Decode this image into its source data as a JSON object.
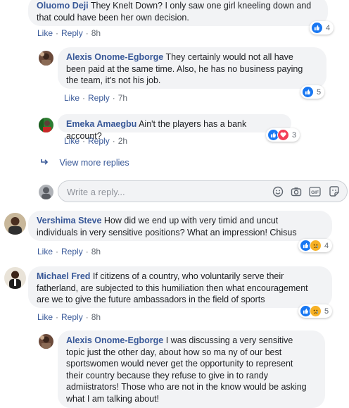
{
  "comments": [
    {
      "name": "Oluomo Deji",
      "text_lines": [
        "They Knelt Down? I only saw one girl kneeling down and",
        "that could have been her own decision."
      ],
      "like": "Like",
      "reply": "Reply",
      "time": "8h",
      "reaction_count": "4"
    },
    {
      "name": "Alexis Onome-Egborge",
      "text_lines": [
        "They certainly would not all have",
        "been paid at the same time. Also, he has no business paying",
        "the team, it's not his job."
      ],
      "like": "Like",
      "reply": "Reply",
      "time": "7h",
      "reaction_count": "5"
    },
    {
      "name": "Emeka Amaegbu",
      "text_lines": [
        "Ain't the players has a bank account?"
      ],
      "like": "Like",
      "reply": "Reply",
      "time": "2h",
      "reaction_count": "3"
    },
    {
      "name": "Vershima Steve",
      "text_lines": [
        "How did we end up with very timid and uncut",
        "individuals in very sensitive positions? What an impression! Chisus"
      ],
      "like": "Like",
      "reply": "Reply",
      "time": "8h",
      "reaction_count": "4"
    },
    {
      "name": "Michael Fred",
      "text_lines": [
        "If citizens of a country, who voluntarily serve their",
        "fatherland, are subjected to this humiliation then what encouragement",
        "are we to give the future ambassadors in the field of sports"
      ],
      "like": "Like",
      "reply": "Reply",
      "time": "8h",
      "reaction_count": "5"
    },
    {
      "name": "Alexis Onome-Egborge",
      "text_lines": [
        "I was discussing a very sensitive",
        "topic just the other day, about how so ma ny of our best",
        "sportswomen would never get the opportunity to represent",
        "their country because they refuse to give in to randy",
        "admiistrators! Those who are not in the know would be asking",
        "what I am talking about!"
      ]
    }
  ],
  "view_more_replies": "View more replies",
  "reply_box": {
    "placeholder": "Write a reply..."
  },
  "colors": {
    "link": "#385898",
    "bubble": "#f2f3f5",
    "meta": "#606770",
    "like": "#1877f2",
    "love": "#f33e58",
    "sad": "#f7b125"
  }
}
